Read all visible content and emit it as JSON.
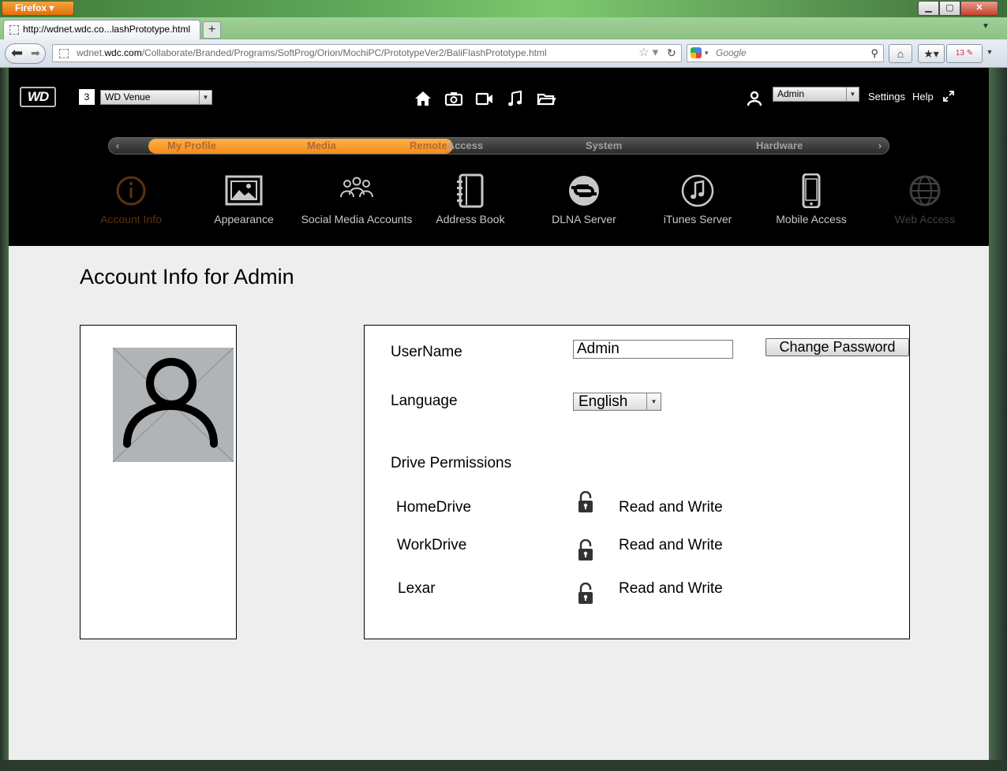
{
  "browser": {
    "app_button": "Firefox",
    "tab_title": "http://wdnet.wdc.co...lashPrototype.html",
    "url_domain": "wdnet.wdc.com",
    "url_prefix": "wdnet.",
    "url_path": "/Collaborate/Branded/Programs/SoftProg/Orion/MochiPC/PrototypeVer2/BaliFlashPrototype.html",
    "search_placeholder": "Google",
    "calendar_badge": "13"
  },
  "app": {
    "logo_text": "WD",
    "device_count": "3",
    "device_selected": "WD Venue",
    "user_selected": "Admin",
    "settings_label": "Settings",
    "help_label": "Help"
  },
  "categories": {
    "items": [
      "My Profile",
      "Media",
      "Remote Access",
      "System",
      "Hardware"
    ],
    "active": "My Profile",
    "remote_part1": "Remote",
    "remote_part2": "Access"
  },
  "features": [
    {
      "label": "Account Info",
      "icon": "info-icon"
    },
    {
      "label": "Appearance",
      "icon": "picture-icon"
    },
    {
      "label": "Social Media Accounts",
      "icon": "people-icon"
    },
    {
      "label": "Address Book",
      "icon": "address-book-icon"
    },
    {
      "label": "DLNA Server",
      "icon": "dlna-icon"
    },
    {
      "label": "iTunes Server",
      "icon": "music-note-icon"
    },
    {
      "label": "Mobile Access",
      "icon": "phone-icon"
    },
    {
      "label": "Web Access",
      "icon": "globe-icon"
    }
  ],
  "page": {
    "title": "Account Info for Admin"
  },
  "form": {
    "username_label": "UserName",
    "username_value": "Admin",
    "change_password_label": "Change Password",
    "language_label": "Language",
    "language_value": "English",
    "permissions_heading": "Drive Permissions",
    "drives": [
      {
        "name": "HomeDrive",
        "permission": "Read and Write"
      },
      {
        "name": "WorkDrive",
        "permission": "Read and Write"
      },
      {
        "name": "Lexar",
        "permission": "Read and Write"
      }
    ]
  },
  "colors": {
    "accent_orange": "#f28b1b",
    "header_black": "#000000",
    "page_bg": "#eeeeee"
  }
}
